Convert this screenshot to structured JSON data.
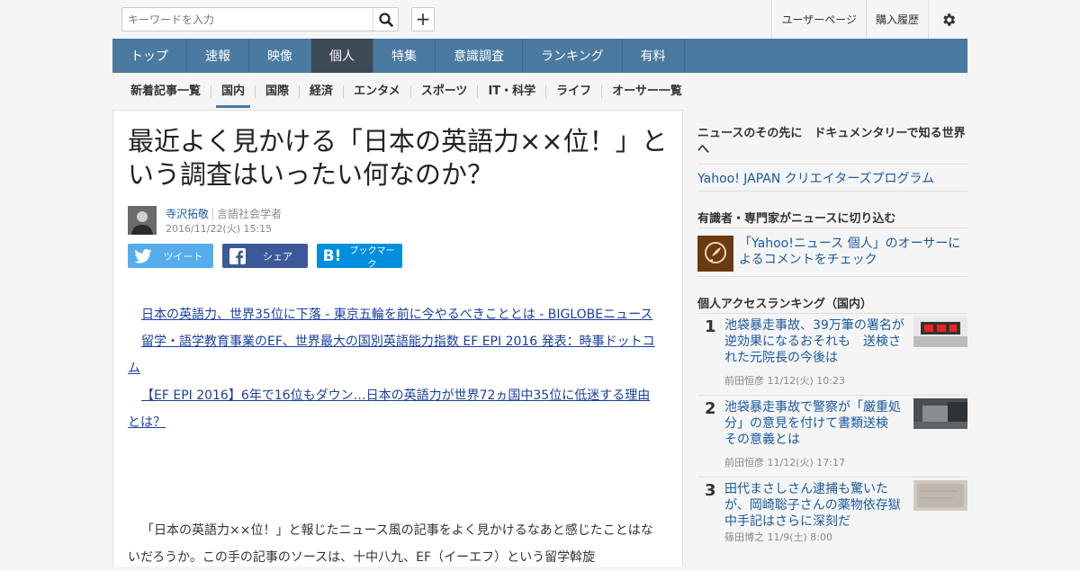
{
  "search": {
    "placeholder": "キーワードを入力"
  },
  "toplinks": {
    "user_page": "ユーザーページ",
    "purchase_history": "購入履歴"
  },
  "nav": [
    "トップ",
    "速報",
    "映像",
    "個人",
    "特集",
    "意識調査",
    "ランキング",
    "有料"
  ],
  "nav_active_index": 3,
  "subnav": [
    "新着記事一覧",
    "国内",
    "国際",
    "経済",
    "エンタメ",
    "スポーツ",
    "IT・科学",
    "ライフ",
    "オーサー一覧"
  ],
  "subnav_active_index": 1,
  "article": {
    "title": "最近よく見かける「日本の英語力××位！」という調査はいったい何なのか？",
    "author_name": "寺沢拓敬",
    "author_role": "言語社会学者",
    "date": "2016/11/22(火) 15:15",
    "share": {
      "twitter": "ツイート",
      "facebook": "シェア",
      "hatena": "ブックマーク"
    },
    "links": [
      "日本の英語力、世界35位に下落 - 東京五輪を前に今やるべきこととは - BIGLOBEニュース",
      "留学・語学教育事業のEF、世界最大の国別英語能力指数 EF EPI 2016 発表：時事ドットコム",
      "【EF EPI 2016】6年で16位もダウン…日本の英語力が世界72ヵ国中35位に低迷する理由とは？"
    ],
    "body": "「日本の英語力××位！」と報じたニュース風の記事をよく見かけるなあと感じたことはないだろうか。この手の記事のソースは、十中八九、EF（イーエフ）という留学斡旋"
  },
  "sidebar": {
    "promo_heading": "ニュースのその先に　ドキュメンタリーで知る世界へ",
    "promo_link": "Yahoo! JAPAN クリエイターズプログラム",
    "expert_heading": "有識者・専門家がニュースに切り込む",
    "expert_link": "「Yahoo!ニュース 個人」のオーサーによるコメントをチェック",
    "ranking_heading": "個人アクセスランキング（国内）",
    "ranking": [
      {
        "rank": "1",
        "title": "池袋暴走事故、39万筆の署名が逆効果になるおそれも　送検された元院長の今後は",
        "author": "前田恒彦",
        "date": "11/12(火) 10:23"
      },
      {
        "rank": "2",
        "title": "池袋暴走事故で警察が「厳重処分」の意見を付けて書類送検 その意義とは",
        "author": "前田恒彦",
        "date": "11/12(火) 17:17"
      },
      {
        "rank": "3",
        "title": "田代まさしさん逮捕も驚いたが、岡崎聡子さんの薬物依存獄中手記はさらに深刻だ",
        "author": "篠田博之",
        "date": "11/9(土) 8:00"
      }
    ]
  }
}
